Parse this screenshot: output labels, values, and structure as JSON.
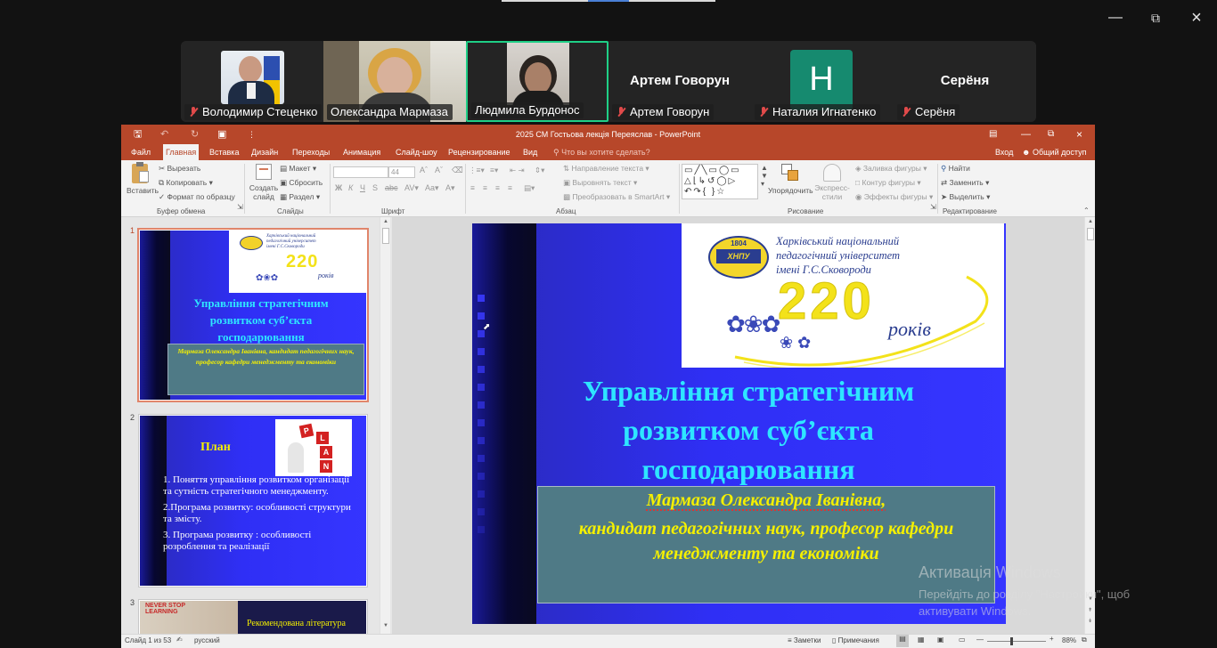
{
  "meeting": {
    "participants": [
      {
        "name": "Володимир Стеценко",
        "muted": true,
        "kind": "video"
      },
      {
        "name": "Олександра Мармаза",
        "muted": false,
        "kind": "video"
      },
      {
        "name": "Людмила Бурдонос",
        "muted": false,
        "kind": "video",
        "active": true
      },
      {
        "name": "Артем Говорун",
        "muted": true,
        "kind": "name"
      },
      {
        "name": "Наталия Игнатенко",
        "muted": true,
        "kind": "avatar",
        "initial": "H"
      },
      {
        "name": "Серёня",
        "muted": true,
        "kind": "name"
      }
    ]
  },
  "powerpoint": {
    "window_title": "2025 СМ Гостьова лекція Переяслав - PowerPoint",
    "tabs": [
      "Файл",
      "Главная",
      "Вставка",
      "Дизайн",
      "Переходы",
      "Анимация",
      "Слайд-шоу",
      "Рецензирование",
      "Вид"
    ],
    "selected_tab": "Главная",
    "tell_me": "Что вы хотите сделать?",
    "sign_in": "Вход",
    "share": "Общий доступ",
    "ribbon": {
      "paste": "Вставить",
      "cut": "Вырезать",
      "copy": "Копировать",
      "format_painter": "Формат по образцу",
      "clipboard_group": "Буфер обмена",
      "new_slide": "Создать слайд",
      "layout": "Макет",
      "reset": "Сбросить",
      "section": "Раздел",
      "slides_group": "Слайды",
      "font_size": "44",
      "font_group": "Шрифт",
      "text_direction": "Направление текста",
      "align_text": "Выровнять текст",
      "smartart": "Преобразовать в SmartArt",
      "paragraph_group": "Абзац",
      "arrange": "Упорядочить",
      "quick_styles": "Экспресс-стили",
      "shape_fill": "Заливка фигуры",
      "shape_outline": "Контур фигуры",
      "shape_effects": "Эффекты фигуры",
      "drawing_group": "Рисование",
      "find": "Найти",
      "replace": "Заменить",
      "select": "Выделить",
      "editing_group": "Редактирование"
    },
    "thumbnails": [
      {
        "number": "1",
        "title": "Управління стратегічним розвитком суб’єкта господарювання",
        "subtitle": "Мармаза Олександра Іванівна, кандидат педагогічних наук, професор кафедри менеджменту та економіки"
      },
      {
        "number": "2",
        "title": "План",
        "items": [
          "1. Поняття управління розвитком організації та сутність стратегічного менеджменту.",
          "2.Програма розвитку: особливості структури та змісту.",
          "3. Програма розвитку : особливості розроблення та реалізації"
        ]
      },
      {
        "number": "3",
        "title": "Рекомендована література",
        "image_text": "NEVER STOP LEARNING"
      }
    ],
    "slide": {
      "university_line1": "Харківський національний",
      "university_line2": "педагогічний університет",
      "university_line3": "імені Г.С.Сковороди",
      "anniversary_number": "220",
      "anniversary_word": "років",
      "seal_year": "1804",
      "seal_text": "ХНПУ",
      "title": "Управління стратегічним розвитком суб’єкта господарювання",
      "author": "Мармаза Олександра Іванівна,",
      "position": "кандидат педагогічних наук, професор кафедри менеджменту та економіки",
      "title_color": "#2ee6ff",
      "author_color": "#f5f000",
      "bg_color": "#2f2ff5"
    },
    "status": {
      "slide_counter": "Слайд 1 из 53",
      "language": "русский",
      "notes": "Заметки",
      "comments": "Примечания",
      "zoom": "88%"
    },
    "watermark": {
      "title": "Активація Windows",
      "line1": "Перейдіть до розділу \"Настройки\", щоб",
      "line2": "активувати Windows."
    }
  }
}
